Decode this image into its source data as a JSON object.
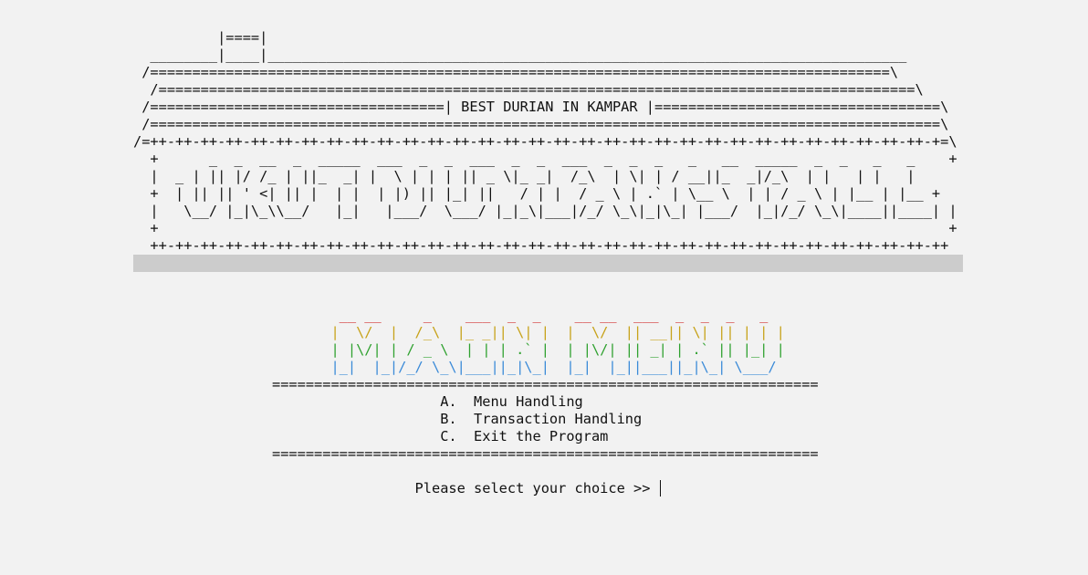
{
  "house": {
    "lines": [
      "          |====|",
      "  ________|____|____________________________________________________________________________",
      " /========================================================================================\\",
      "  /==========================================================================================\\",
      " /===================================| BEST DURIAN IN KAMPAR |==================================\\",
      " /==============================================================================================\\",
      "/=++-++-++-++-++-++-++-++-++-++-++-++-++-++-++-++-++-++-++-++-++-++-++-++-++-++-++-++-++-++-++-+=\\",
      "  +      _  _  __  _  _____  ___  _  _  ___  _  _  ___  _  _  _   _   __  _____  _  _   _   _    +",
      "  |  _ | || |/ /_ | ||_  _| |  \\ | | | || _ \\|_ _|  /_\\  | \\| | / __||_  _|/_\\  | |   | |   |",
      "  +  | || || ' <| || |  | |  | |) || |_| ||   / | |  / _ \\ | .` | \\__ \\  | | / _ \\ | |__ | |__ +",
      "  |   \\__/ |_|\\_\\\\__/   |_|   |___/  \\___/ |_|_\\|___|/_/ \\_\\|_|\\_| |___/  |_|/_/ \\_\\|____||____| |",
      "  +                                                                                              +",
      "  ++-++-++-++-++-++-++-++-++-++-++-++-++-++-++-++-++-++-++-++-++-++-++-++-++-++-++-++-++-++-++-++"
    ]
  },
  "menu": {
    "title_lines": [
      "        __ __     _    ___  _  _    __ __  ___  _  _  _   _",
      "       |  \\/  |  /_\\  |_ _|| \\| |  |  \\/  || __|| \\| || | | |",
      "       | |\\/| | / _ \\  | | | .` |  | |\\/| || _| | .` || |_| |",
      "       |_|  |_|/_/ \\_\\|___||_|\\_|  |_|  |_||___||_|\\_| \\___/"
    ],
    "title_colors": [
      "#d12b2b",
      "#c7a219",
      "#2fa12f",
      "#3a8ad8"
    ],
    "separator": "=================================================================",
    "options": [
      "                    A.  Menu Handling",
      "                    B.  Transaction Handling",
      "                    C.  Exit the Program"
    ],
    "blank": "",
    "prompt": "                 Please select your choice >> "
  }
}
